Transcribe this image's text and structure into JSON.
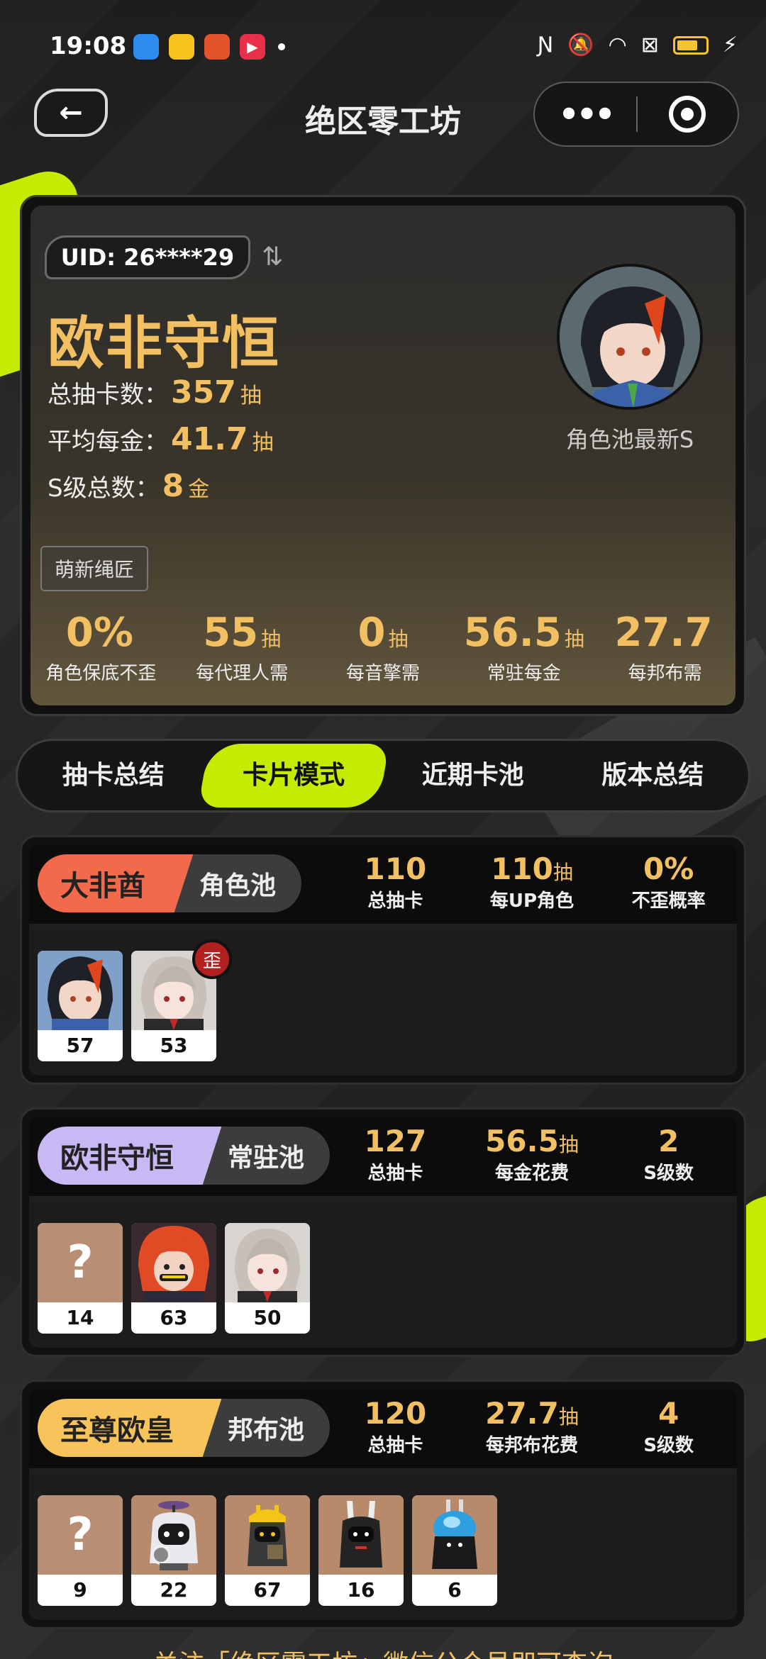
{
  "status_bar": {
    "time": "19:08"
  },
  "nav": {
    "back_glyph": "←",
    "title": "绝区零工坊",
    "more_glyph": "•••"
  },
  "profile": {
    "uid": "UID: 26****29",
    "swap_glyph": "⇅",
    "rank_title": "欧非守恒",
    "stats": [
      {
        "label": "总抽卡数：",
        "value": "357",
        "unit": "抽"
      },
      {
        "label": "平均每金：",
        "value": "41.7",
        "unit": "抽"
      },
      {
        "label": "S级总数：",
        "value": "8",
        "unit": "金"
      }
    ],
    "avatar_label": "角色池最新S",
    "tag": "萌新绳匠",
    "metrics": [
      {
        "value": "0%",
        "unit": "",
        "label": "角色保底不歪"
      },
      {
        "value": "55",
        "unit": "抽",
        "label": "每代理人需"
      },
      {
        "value": "0",
        "unit": "抽",
        "label": "每音擎需"
      },
      {
        "value": "56.5",
        "unit": "抽",
        "label": "常驻每金"
      },
      {
        "value": "27.7",
        "unit": "",
        "label": "每邦布需"
      }
    ]
  },
  "tabs": [
    "抽卡总结",
    "卡片模式",
    "近期卡池",
    "版本总结"
  ],
  "active_tab": 1,
  "pools": [
    {
      "rank": "大非酋",
      "rank_color": "#f26a4b",
      "pool": "角色池",
      "stats": [
        {
          "value": "110",
          "unit": "",
          "label": "总抽卡"
        },
        {
          "value": "110",
          "unit": "抽",
          "label": "每UP角色"
        },
        {
          "value": "0%",
          "unit": "",
          "label": "不歪概率"
        }
      ],
      "pulls": [
        {
          "num": "57",
          "kind": "agent-dark",
          "badge": ""
        },
        {
          "num": "53",
          "kind": "agent-white",
          "badge": "歪"
        }
      ]
    },
    {
      "rank": "欧非守恒",
      "rank_color": "#c8b8f4",
      "pool": "常驻池",
      "stats": [
        {
          "value": "127",
          "unit": "",
          "label": "总抽卡"
        },
        {
          "value": "56.5",
          "unit": "抽",
          "label": "每金花费"
        },
        {
          "value": "2",
          "unit": "",
          "label": "S级数"
        }
      ],
      "pulls": [
        {
          "num": "14",
          "kind": "unknown",
          "badge": ""
        },
        {
          "num": "63",
          "kind": "agent-red",
          "badge": ""
        },
        {
          "num": "50",
          "kind": "agent-white",
          "badge": ""
        }
      ]
    },
    {
      "rank": "至尊欧皇",
      "rank_color": "#f6c45a",
      "pool": "邦布池",
      "stats": [
        {
          "value": "120",
          "unit": "",
          "label": "总抽卡"
        },
        {
          "value": "27.7",
          "unit": "抽",
          "label": "每邦布花费"
        },
        {
          "value": "4",
          "unit": "",
          "label": "S级数"
        }
      ],
      "pulls": [
        {
          "num": "9",
          "kind": "unknown",
          "badge": ""
        },
        {
          "num": "22",
          "kind": "bangboo-white",
          "badge": ""
        },
        {
          "num": "67",
          "kind": "bangboo-yellow",
          "badge": ""
        },
        {
          "num": "16",
          "kind": "bangboo-black",
          "badge": ""
        },
        {
          "num": "6",
          "kind": "bangboo-blue",
          "badge": ""
        }
      ]
    }
  ],
  "footer_text": "关注「绝区零工坊」微信公众号即可查询"
}
